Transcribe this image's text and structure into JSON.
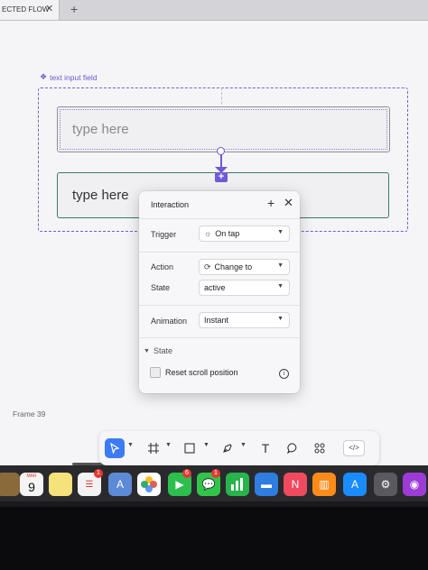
{
  "browser": {
    "tab_title": "ECTED FLOW",
    "close_glyph": "✕",
    "new_tab_glyph": "+"
  },
  "canvas": {
    "component_label": "text input field",
    "variants": [
      {
        "placeholder": "type here"
      },
      {
        "placeholder": "type here"
      }
    ],
    "frame_label": "Frame 39"
  },
  "interaction_panel": {
    "title": "Interaction",
    "add_glyph": "+",
    "close_glyph": "✕",
    "trigger_label": "Trigger",
    "trigger_value": "On tap",
    "action_label": "Action",
    "action_value": "Change to",
    "state_label": "State",
    "state_value": "active",
    "animation_label": "Animation",
    "animation_value": "Instant",
    "state_section_label": "State",
    "reset_scroll_label": "Reset scroll position",
    "reset_scroll_checked": false,
    "info_glyph": "i"
  },
  "toolbar": {
    "code_label": "</>",
    "icons": [
      "move-tool-icon",
      "frame-tool-icon",
      "rectangle-tool-icon",
      "pen-tool-icon",
      "text-tool-icon",
      "comment-tool-icon",
      "components-icon"
    ]
  },
  "dock": {
    "calendar_month": "MAR",
    "calendar_day": "9",
    "badges": {
      "reminders": "1",
      "facetime": "6",
      "messages": "1"
    }
  },
  "colors": {
    "accent_purple": "#6f5bd6",
    "selected_tool_blue": "#3d7bf5",
    "badge_red": "#e53935",
    "variant_border_green": "#3d7a62"
  }
}
